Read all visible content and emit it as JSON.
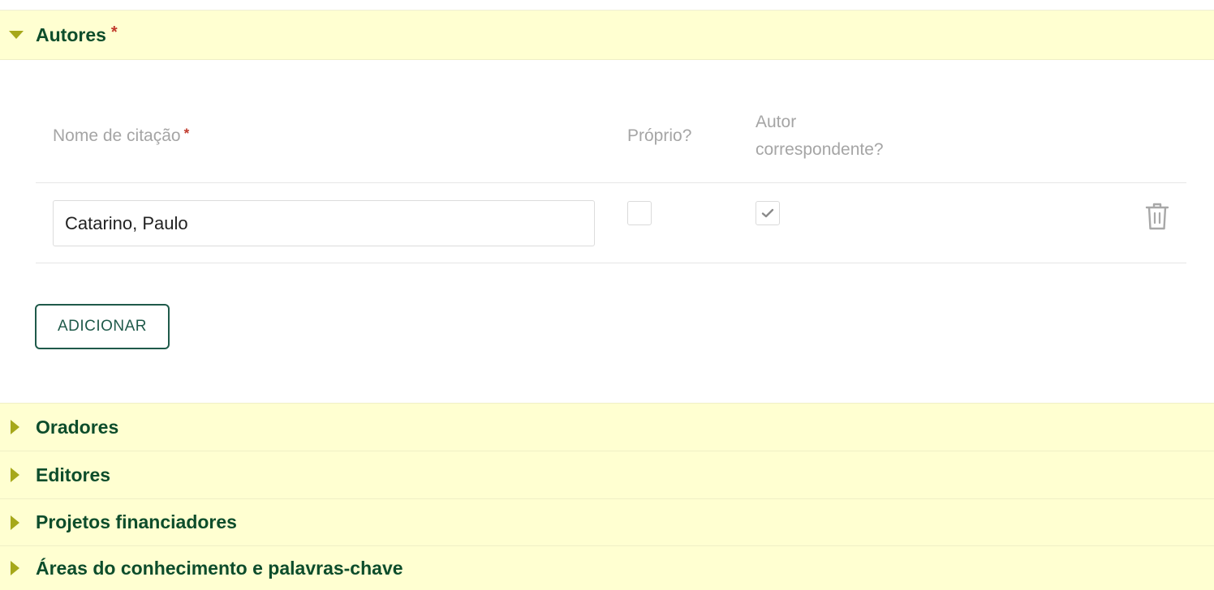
{
  "sections": {
    "autores": {
      "title": "Autores",
      "required": "*"
    },
    "oradores": {
      "title": "Oradores"
    },
    "editores": {
      "title": "Editores"
    },
    "projetos": {
      "title": "Projetos financiadores"
    },
    "areas": {
      "title": "Áreas do conhecimento e palavras-chave"
    }
  },
  "authors_table": {
    "columns": {
      "name": "Nome de citação",
      "name_required": "*",
      "own": "Próprio?",
      "corresponding_line1": "Autor",
      "corresponding_line2": "correspondente?"
    },
    "rows": [
      {
        "name": "Catarino, Paulo",
        "own": false,
        "corresponding": true
      }
    ]
  },
  "add_button": {
    "label": "ADICIONAR"
  },
  "icons": {
    "expanded": "triangle-down-icon",
    "collapsed": "triangle-right-icon",
    "delete": "trash-icon",
    "check": "check-icon"
  },
  "colors": {
    "header_bg": "#ffffd1",
    "title": "#0d4d2b",
    "arrow": "#a6a81a",
    "required": "#c0392b",
    "button_border": "#1f5a4a"
  }
}
